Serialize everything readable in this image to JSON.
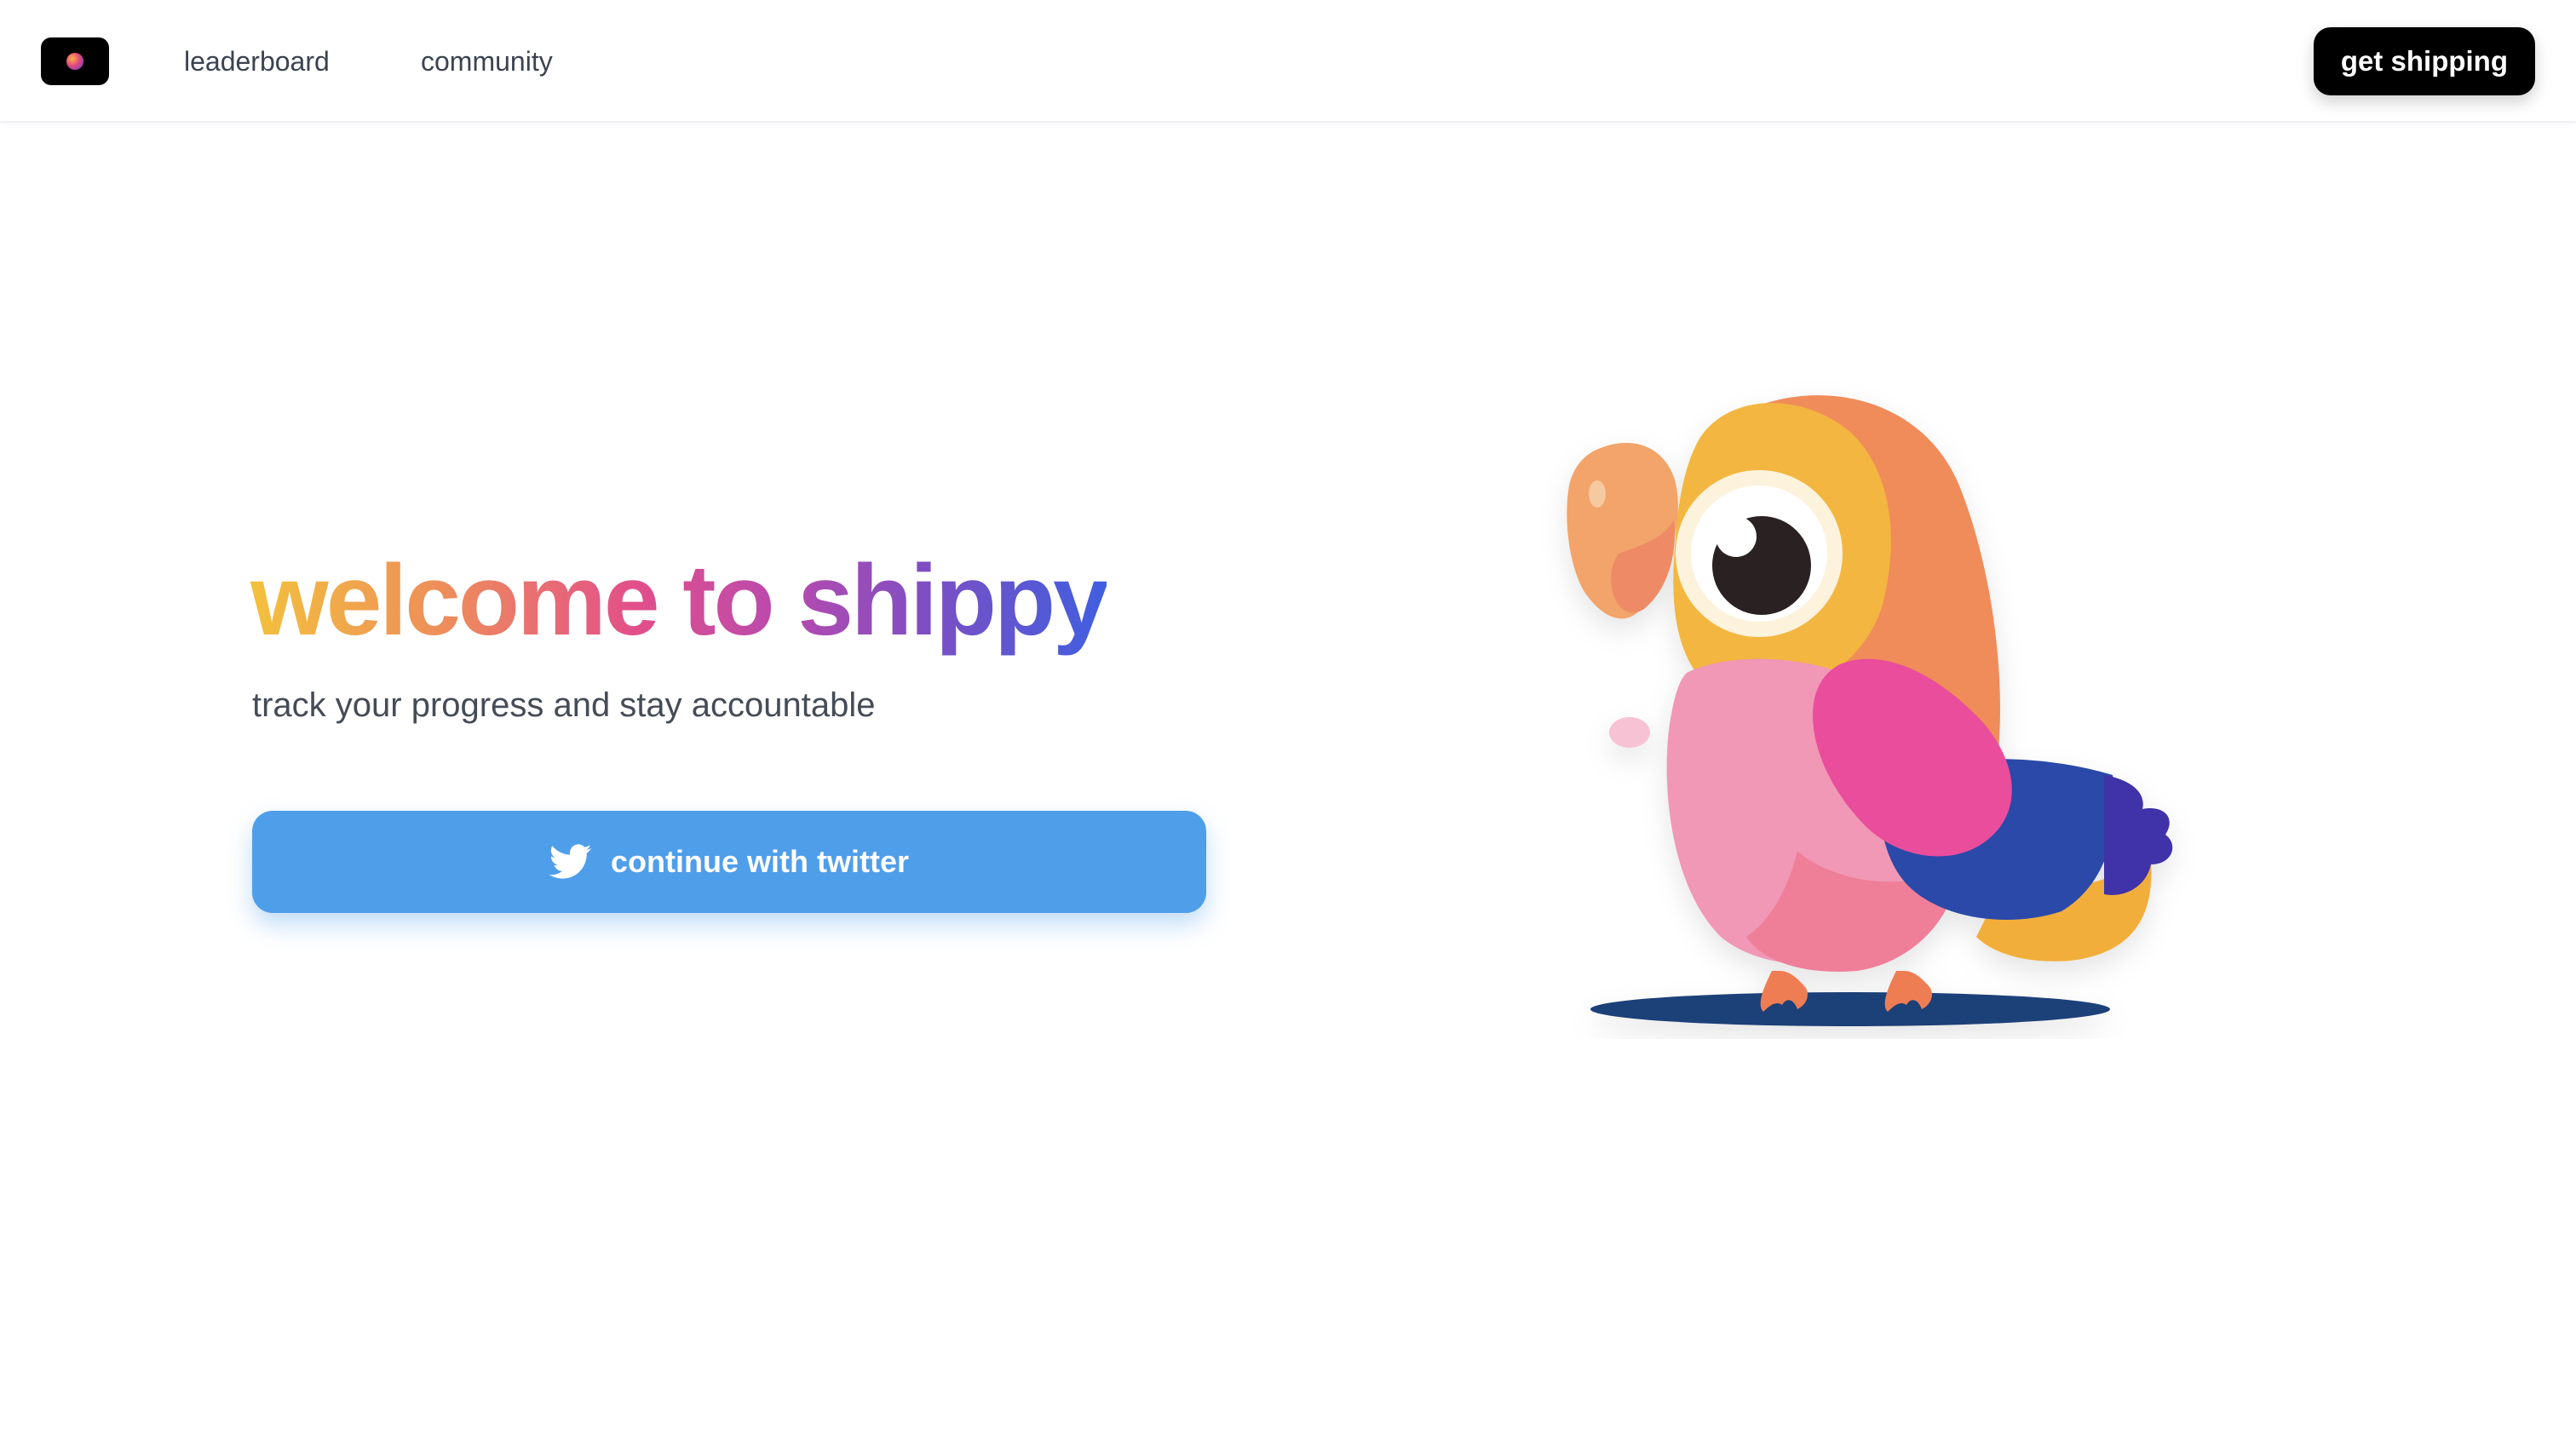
{
  "nav": {
    "logo_icon": "shippy-logo-icon",
    "links": [
      "leaderboard",
      "community"
    ],
    "cta_label": "get shipping"
  },
  "hero": {
    "title": "welcome to shippy",
    "subtitle": "track your progress and stay accountable",
    "login_button_label": "continue with twitter",
    "login_button_icon": "twitter-bird-icon"
  },
  "illustration": {
    "name": "parrot-mascot"
  },
  "colors": {
    "twitter_blue": "#4f9eea",
    "title_gradient": [
      "#f3c13c",
      "#ee8f5a",
      "#e24f8a",
      "#b94aae",
      "#7a4fc4",
      "#3f5fe0"
    ],
    "cta_background": "#000000"
  }
}
